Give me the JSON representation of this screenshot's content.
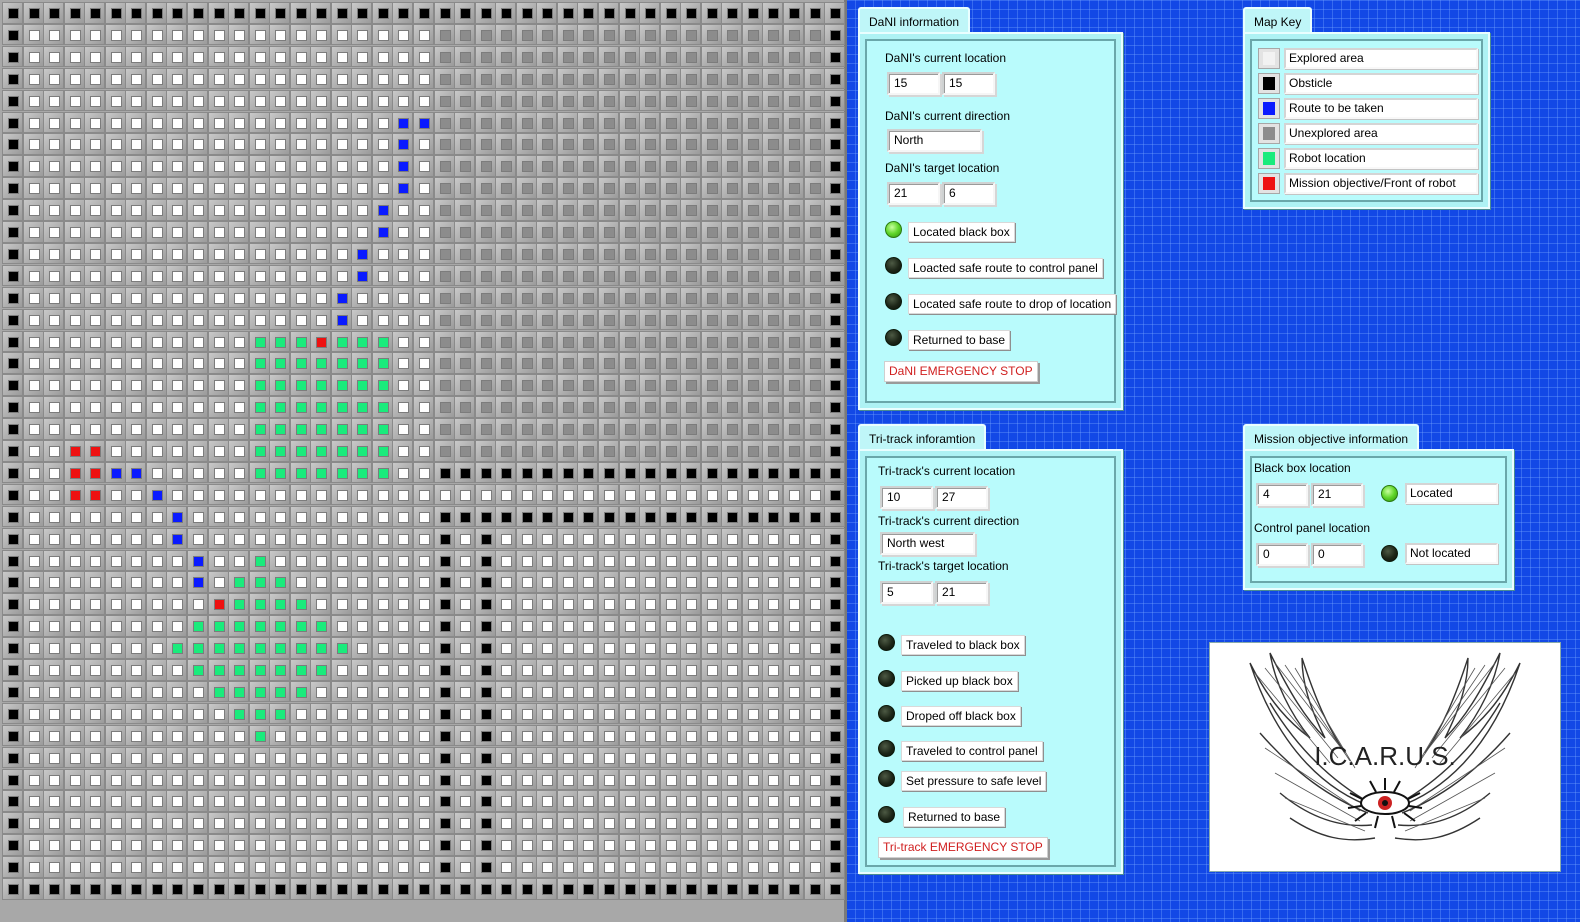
{
  "map": {
    "columns": 41,
    "rows": 41,
    "colors": {
      "explored": "#ffffff",
      "obstacle": "#000000",
      "route": "#0a1aff",
      "unexplored": "#8c8c8c",
      "robot": "#1aeb7c",
      "objective": "#ee1111"
    },
    "region_fills": [
      {
        "state": "explored",
        "row_start": 1,
        "row_end": 39,
        "col_start": 1,
        "col_end": 20
      },
      {
        "state": "unexplored",
        "row_start": 1,
        "row_end": 20,
        "col_start": 21,
        "col_end": 39
      },
      {
        "state": "explored",
        "row_start": 22,
        "row_end": 39,
        "col_start": 21,
        "col_end": 39
      }
    ],
    "obstacle_runs": [
      {
        "row": 0,
        "col_start": 0,
        "col_end": 40
      },
      {
        "row": 40,
        "col_start": 0,
        "col_end": 40
      },
      {
        "col": 0,
        "row_start": 0,
        "row_end": 40
      },
      {
        "col": 40,
        "row_start": 0,
        "row_end": 40
      },
      {
        "row": 21,
        "col_start": 21,
        "col_end": 39
      },
      {
        "row": 23,
        "col_start": 21,
        "col_end": 39
      },
      {
        "col": 21,
        "row_start": 24,
        "row_end": 39
      },
      {
        "col": 23,
        "row_start": 24,
        "row_end": 39
      }
    ],
    "route_cells": [
      [
        5,
        19
      ],
      [
        5,
        20
      ],
      [
        6,
        19
      ],
      [
        7,
        19
      ],
      [
        8,
        19
      ],
      [
        9,
        18
      ],
      [
        10,
        18
      ],
      [
        11,
        17
      ],
      [
        12,
        17
      ],
      [
        13,
        16
      ],
      [
        14,
        16
      ],
      [
        21,
        5
      ],
      [
        21,
        6
      ],
      [
        22,
        7
      ],
      [
        23,
        8
      ],
      [
        24,
        8
      ],
      [
        25,
        9
      ],
      [
        26,
        9
      ]
    ],
    "objective_cells": [
      [
        15,
        15
      ],
      [
        20,
        3
      ],
      [
        20,
        4
      ],
      [
        21,
        3
      ],
      [
        21,
        4
      ],
      [
        22,
        3
      ],
      [
        22,
        4
      ],
      [
        27,
        10
      ]
    ],
    "robot_cells": [
      [
        15,
        12
      ],
      [
        15,
        13
      ],
      [
        15,
        14
      ],
      [
        15,
        16
      ],
      [
        15,
        17
      ],
      [
        15,
        18
      ],
      [
        16,
        12
      ],
      [
        16,
        13
      ],
      [
        16,
        14
      ],
      [
        16,
        15
      ],
      [
        16,
        16
      ],
      [
        16,
        17
      ],
      [
        16,
        18
      ],
      [
        17,
        12
      ],
      [
        17,
        13
      ],
      [
        17,
        14
      ],
      [
        17,
        15
      ],
      [
        17,
        16
      ],
      [
        17,
        17
      ],
      [
        17,
        18
      ],
      [
        18,
        12
      ],
      [
        18,
        13
      ],
      [
        18,
        14
      ],
      [
        18,
        15
      ],
      [
        18,
        16
      ],
      [
        18,
        17
      ],
      [
        18,
        18
      ],
      [
        19,
        12
      ],
      [
        19,
        13
      ],
      [
        19,
        14
      ],
      [
        19,
        15
      ],
      [
        19,
        16
      ],
      [
        19,
        17
      ],
      [
        19,
        18
      ],
      [
        20,
        12
      ],
      [
        20,
        13
      ],
      [
        20,
        14
      ],
      [
        20,
        15
      ],
      [
        20,
        16
      ],
      [
        20,
        17
      ],
      [
        20,
        18
      ],
      [
        21,
        12
      ],
      [
        21,
        13
      ],
      [
        21,
        14
      ],
      [
        21,
        15
      ],
      [
        21,
        16
      ],
      [
        21,
        17
      ],
      [
        21,
        18
      ],
      [
        25,
        12
      ],
      [
        26,
        11
      ],
      [
        26,
        12
      ],
      [
        26,
        13
      ],
      [
        27,
        11
      ],
      [
        27,
        12
      ],
      [
        27,
        13
      ],
      [
        27,
        14
      ],
      [
        28,
        9
      ],
      [
        28,
        10
      ],
      [
        28,
        11
      ],
      [
        28,
        12
      ],
      [
        28,
        13
      ],
      [
        28,
        14
      ],
      [
        28,
        15
      ],
      [
        29,
        8
      ],
      [
        29,
        9
      ],
      [
        29,
        10
      ],
      [
        29,
        11
      ],
      [
        29,
        12
      ],
      [
        29,
        13
      ],
      [
        29,
        14
      ],
      [
        29,
        15
      ],
      [
        29,
        16
      ],
      [
        30,
        9
      ],
      [
        30,
        10
      ],
      [
        30,
        11
      ],
      [
        30,
        12
      ],
      [
        30,
        13
      ],
      [
        30,
        14
      ],
      [
        30,
        15
      ],
      [
        31,
        10
      ],
      [
        31,
        11
      ],
      [
        31,
        12
      ],
      [
        31,
        13
      ],
      [
        31,
        14
      ],
      [
        32,
        11
      ],
      [
        32,
        12
      ],
      [
        32,
        13
      ],
      [
        33,
        12
      ]
    ]
  },
  "dani": {
    "tab": "DaNI information",
    "current_location_label": "DaNI's current location",
    "current_location": [
      "15",
      "15"
    ],
    "current_direction_label": "DaNI's current direction",
    "current_direction": "North",
    "target_location_label": "DaNI's target location",
    "target_location": [
      "21",
      "6"
    ],
    "indicators": [
      {
        "label": "Located black box",
        "on": true
      },
      {
        "label": "Loacted safe route to control panel",
        "on": false
      },
      {
        "label": "Located safe route to drop of location",
        "on": false
      },
      {
        "label": "Returned to base",
        "on": false
      }
    ],
    "emergency_stop": "DaNI EMERGENCY STOP"
  },
  "tritrack": {
    "tab": "Tri-track inforamtion",
    "current_location_label": "Tri-track's current location",
    "current_location": [
      "10",
      "27"
    ],
    "current_direction_label": "Tri-track's current direction",
    "current_direction": "North west",
    "target_location_label": "Tri-track's target location",
    "target_location": [
      "5",
      "21"
    ],
    "indicators": [
      {
        "label": "Traveled to black box",
        "on": false
      },
      {
        "label": "Picked up black box",
        "on": false
      },
      {
        "label": "Droped off black box",
        "on": false
      },
      {
        "label": "Traveled to control panel",
        "on": false
      },
      {
        "label": "Set pressure to safe level",
        "on": false
      },
      {
        "label": "Returned to base",
        "on": false
      }
    ],
    "emergency_stop": "Tri-track EMERGENCY STOP"
  },
  "map_key": {
    "tab": "Map Key",
    "entries": [
      {
        "label": "Explored area",
        "color": "#f2f2f2"
      },
      {
        "label": "Obsticle",
        "color": "#000000"
      },
      {
        "label": "Route to be taken",
        "color": "#0a1aff"
      },
      {
        "label": "Unexplored area",
        "color": "#8c8c8c"
      },
      {
        "label": "Robot location",
        "color": "#1aeb7c"
      },
      {
        "label": "Mission objective/Front of robot",
        "color": "#ee1111"
      }
    ]
  },
  "mission": {
    "tab": "Mission objective information",
    "black_box_label": "Black box location",
    "black_box_location": [
      "4",
      "21"
    ],
    "black_box_status": "Located",
    "black_box_on": true,
    "control_panel_label": "Control panel location",
    "control_panel_location": [
      "0",
      "0"
    ],
    "control_panel_status": "Not located",
    "control_panel_on": false
  },
  "logo": {
    "text": "I.C.A.R.U.S."
  }
}
